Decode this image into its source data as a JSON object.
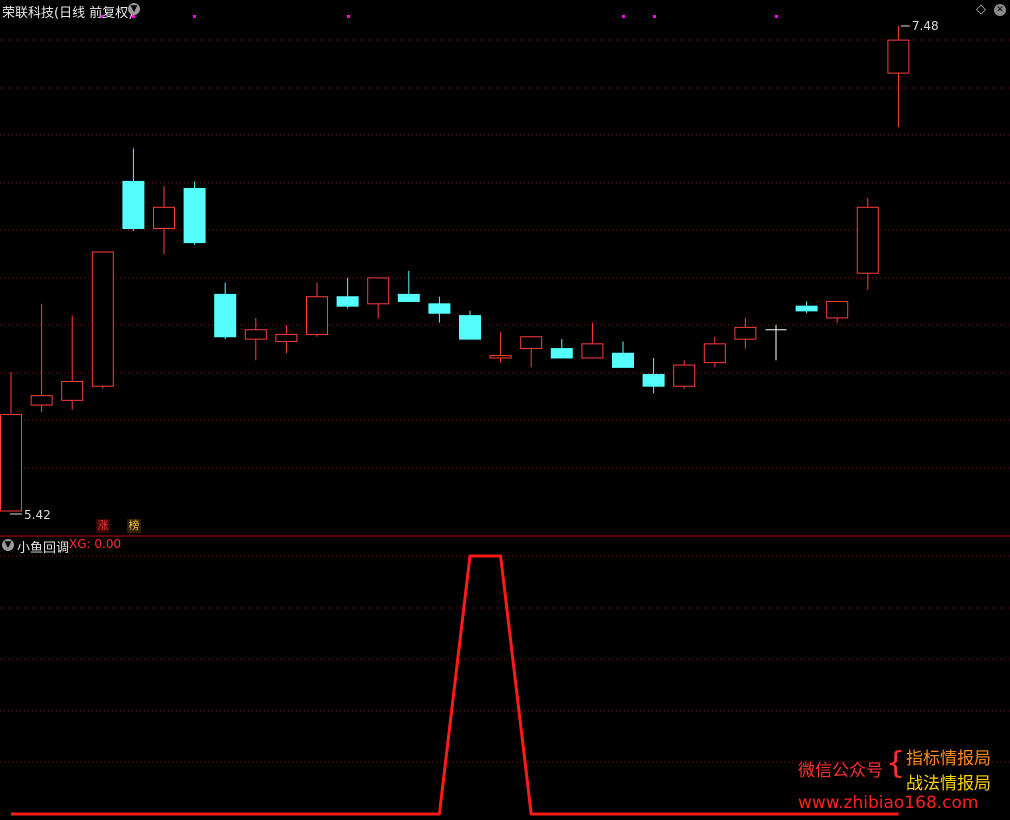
{
  "header": {
    "title": "荣联科技(日线 前复权)",
    "top_right_icons": [
      "diamond-icon",
      "close-icon"
    ]
  },
  "price_panel": {
    "high_label": "7.48",
    "low_label": "5.42",
    "badges": [
      "涨",
      "榜"
    ],
    "colors": {
      "up": "#ff3c3c",
      "down": "#54fcfc",
      "doji": "#ffffff",
      "grid": "#8a1010",
      "marker": "#ff00ff"
    }
  },
  "indicator": {
    "name": "小鱼回调",
    "value_text": "XG: 0.00",
    "line_color": "#ff1a1a"
  },
  "watermark": {
    "left": "微信公众号",
    "line1": "指标情报局",
    "line2": "战法情报局",
    "url": "www.zhibiao168.com"
  },
  "chart_data": [
    {
      "type": "candlestick",
      "title": "荣联科技(日线 前复权)",
      "ylim": [
        5.42,
        7.48
      ],
      "candles": [
        {
          "o": 5.42,
          "c": 5.83,
          "h": 6.01,
          "l": 5.42,
          "dir": "up"
        },
        {
          "o": 5.87,
          "c": 5.91,
          "h": 6.3,
          "l": 5.84,
          "dir": "up"
        },
        {
          "o": 5.89,
          "c": 5.97,
          "h": 6.25,
          "l": 5.85,
          "dir": "up"
        },
        {
          "o": 5.95,
          "c": 6.52,
          "h": 6.52,
          "l": 5.94,
          "dir": "up"
        },
        {
          "o": 6.82,
          "c": 6.62,
          "h": 6.96,
          "l": 6.61,
          "dir": "down"
        },
        {
          "o": 6.62,
          "c": 6.71,
          "h": 6.8,
          "l": 6.51,
          "dir": "up"
        },
        {
          "o": 6.79,
          "c": 6.56,
          "h": 6.82,
          "l": 6.55,
          "dir": "down"
        },
        {
          "o": 6.34,
          "c": 6.16,
          "h": 6.39,
          "l": 6.15,
          "dir": "down"
        },
        {
          "o": 6.15,
          "c": 6.19,
          "h": 6.24,
          "l": 6.06,
          "dir": "up"
        },
        {
          "o": 6.14,
          "c": 6.17,
          "h": 6.21,
          "l": 6.09,
          "dir": "up"
        },
        {
          "o": 6.17,
          "c": 6.33,
          "h": 6.39,
          "l": 6.16,
          "dir": "up"
        },
        {
          "o": 6.33,
          "c": 6.29,
          "h": 6.41,
          "l": 6.28,
          "dir": "down"
        },
        {
          "o": 6.3,
          "c": 6.41,
          "h": 6.41,
          "l": 6.24,
          "dir": "up"
        },
        {
          "o": 6.34,
          "c": 6.31,
          "h": 6.44,
          "l": 6.31,
          "dir": "down"
        },
        {
          "o": 6.3,
          "c": 6.26,
          "h": 6.33,
          "l": 6.22,
          "dir": "down"
        },
        {
          "o": 6.25,
          "c": 6.15,
          "h": 6.27,
          "l": 6.15,
          "dir": "down"
        },
        {
          "o": 6.07,
          "c": 6.08,
          "h": 6.18,
          "l": 6.05,
          "dir": "up"
        },
        {
          "o": 6.11,
          "c": 6.16,
          "h": 6.16,
          "l": 6.03,
          "dir": "up"
        },
        {
          "o": 6.11,
          "c": 6.07,
          "h": 6.15,
          "l": 6.07,
          "dir": "down"
        },
        {
          "o": 6.07,
          "c": 6.13,
          "h": 6.22,
          "l": 6.07,
          "dir": "up"
        },
        {
          "o": 6.09,
          "c": 6.03,
          "h": 6.14,
          "l": 6.03,
          "dir": "down"
        },
        {
          "o": 6.0,
          "c": 5.95,
          "h": 6.07,
          "l": 5.92,
          "dir": "down"
        },
        {
          "o": 5.95,
          "c": 6.04,
          "h": 6.06,
          "l": 5.94,
          "dir": "up"
        },
        {
          "o": 6.05,
          "c": 6.13,
          "h": 6.16,
          "l": 6.03,
          "dir": "up"
        },
        {
          "o": 6.15,
          "c": 6.2,
          "h": 6.24,
          "l": 6.11,
          "dir": "up"
        },
        {
          "o": 6.19,
          "c": 6.19,
          "h": 6.21,
          "l": 6.06,
          "dir": "doji"
        },
        {
          "o": 6.29,
          "c": 6.27,
          "h": 6.31,
          "l": 6.26,
          "dir": "down"
        },
        {
          "o": 6.24,
          "c": 6.31,
          "h": 6.31,
          "l": 6.22,
          "dir": "up"
        },
        {
          "o": 6.43,
          "c": 6.71,
          "h": 6.75,
          "l": 6.36,
          "dir": "up"
        },
        {
          "o": 7.28,
          "c": 7.42,
          "h": 7.48,
          "l": 7.05,
          "dir": "up"
        }
      ]
    },
    {
      "type": "line",
      "title": "小鱼回调",
      "series": [
        {
          "name": "XG",
          "values": [
            0,
            0,
            0,
            0,
            0,
            0,
            0,
            0,
            0,
            0,
            0,
            0,
            0,
            0,
            0,
            1,
            1,
            0,
            0,
            0,
            0,
            0,
            0,
            0,
            0,
            0,
            0,
            0,
            0,
            0
          ]
        }
      ],
      "ylim": [
        0,
        1
      ]
    }
  ]
}
